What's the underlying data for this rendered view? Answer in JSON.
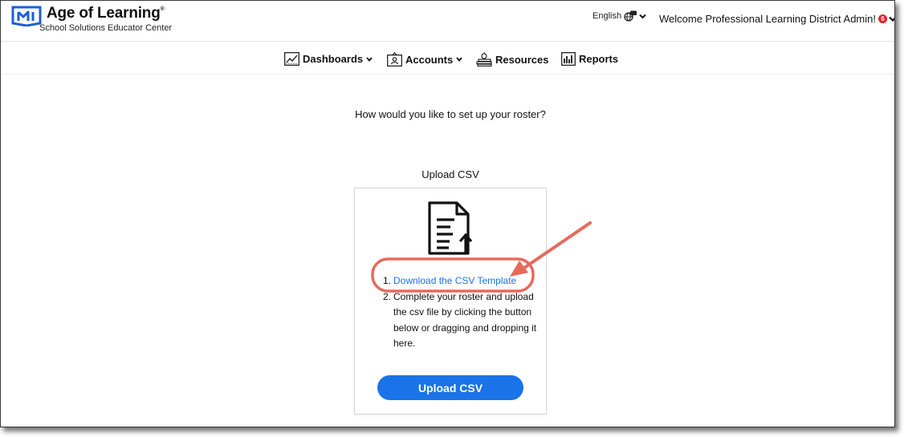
{
  "header": {
    "brand_title": "Age of Learning",
    "brand_sup": "®",
    "brand_subtitle": "School Solutions Educator Center",
    "language": "English",
    "welcome": "Welcome Professional Learning District Admin!",
    "notification_count": "6"
  },
  "nav": {
    "items": [
      {
        "label": "Dashboards",
        "icon": "chart-line-icon",
        "has_dropdown": true
      },
      {
        "label": "Accounts",
        "icon": "id-card-icon",
        "has_dropdown": true
      },
      {
        "label": "Resources",
        "icon": "books-apple-icon",
        "has_dropdown": false
      },
      {
        "label": "Reports",
        "icon": "bar-chart-icon",
        "has_dropdown": false
      }
    ]
  },
  "main": {
    "question": "How would you like to set up your roster?",
    "upload_title": "Upload CSV",
    "steps": [
      {
        "number": "1.",
        "text": "Download the CSV Template"
      },
      {
        "number": "2.",
        "text": "Complete your roster and upload the csv file by clicking the button below or dragging and dropping it here."
      }
    ],
    "upload_button": "Upload CSV"
  },
  "colors": {
    "brand_blue": "#1a5fd6",
    "link_blue": "#1a73e8",
    "button_blue": "#1a73e8",
    "annotation_red": "#e8685c",
    "notification_red": "#e0242b"
  }
}
